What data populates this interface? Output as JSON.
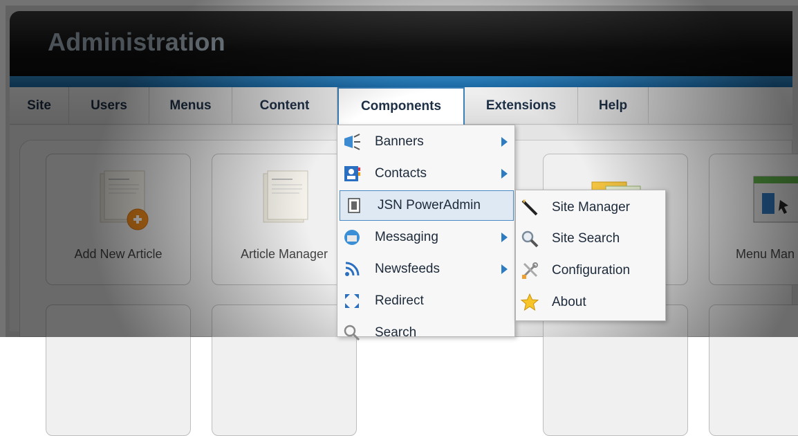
{
  "header": {
    "title": "Administration"
  },
  "menubar": {
    "items": [
      {
        "label": "Site"
      },
      {
        "label": "Users"
      },
      {
        "label": "Menus"
      },
      {
        "label": "Content"
      },
      {
        "label": "Components"
      },
      {
        "label": "Extensions"
      },
      {
        "label": "Help"
      }
    ],
    "active_index": 4
  },
  "tiles": [
    {
      "label": "Add New Article",
      "icon": "add-article-icon"
    },
    {
      "label": "Article Manager",
      "icon": "article-manager-icon"
    },
    {
      "label": "",
      "icon": "media-icon"
    },
    {
      "label": "Menu Man",
      "icon": "menu-manager-icon"
    }
  ],
  "components_menu": {
    "items": [
      {
        "label": "Banners",
        "icon": "banners-icon",
        "has_submenu": true
      },
      {
        "label": "Contacts",
        "icon": "contacts-icon",
        "has_submenu": true
      },
      {
        "label": "JSN PowerAdmin",
        "icon": "jsn-poweradmin-icon",
        "has_submenu": false,
        "highlighted": true
      },
      {
        "label": "Messaging",
        "icon": "messaging-icon",
        "has_submenu": true
      },
      {
        "label": "Newsfeeds",
        "icon": "newsfeeds-icon",
        "has_submenu": true
      },
      {
        "label": "Redirect",
        "icon": "redirect-icon",
        "has_submenu": false
      },
      {
        "label": "Search",
        "icon": "search-icon",
        "has_submenu": false
      }
    ]
  },
  "poweradmin_submenu": {
    "items": [
      {
        "label": "Site Manager",
        "icon": "wand-icon"
      },
      {
        "label": "Site Search",
        "icon": "magnifier-icon"
      },
      {
        "label": "Configuration",
        "icon": "tools-icon"
      },
      {
        "label": "About",
        "icon": "star-icon"
      }
    ]
  },
  "colors": {
    "accent_blue": "#2d7cc2",
    "header_title": "#a9b8c4",
    "menu_text": "#1d2f45"
  }
}
